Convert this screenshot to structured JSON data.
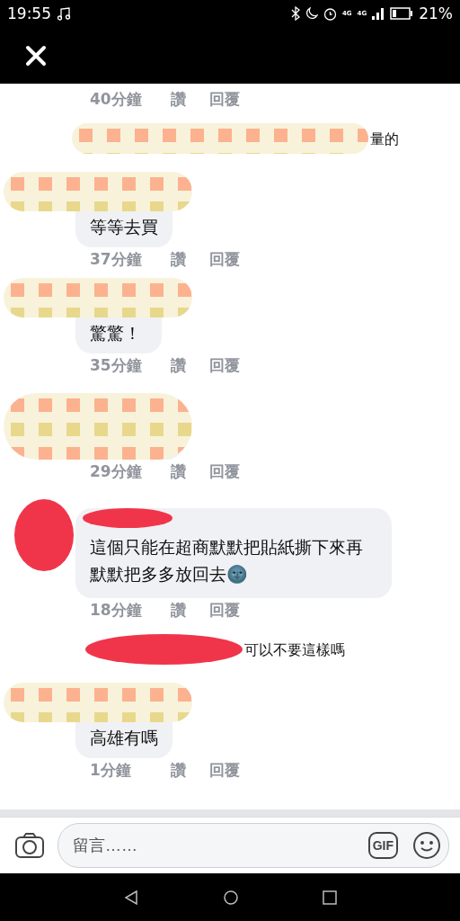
{
  "status_bar": {
    "time": "19:55",
    "network_labels": [
      "4G",
      "4G"
    ],
    "battery_text": "21%"
  },
  "items": [
    {
      "kind": "meta",
      "time": "40分鐘",
      "like": "讚",
      "reply": "回覆"
    },
    {
      "kind": "reply_preview",
      "redaction": {
        "kind": "checker"
      },
      "text": "量的"
    },
    {
      "kind": "comment",
      "redaction": {
        "kind": "checker"
      },
      "text": "等等去買",
      "time": "37分鐘",
      "like": "讚",
      "reply": "回覆"
    },
    {
      "kind": "comment",
      "redaction": {
        "kind": "checker"
      },
      "text": "驚驚！",
      "time": "35分鐘",
      "like": "讚",
      "reply": "回覆"
    },
    {
      "kind": "comment",
      "redaction": {
        "kind": "checker"
      },
      "time": "29分鐘",
      "like": "讚",
      "reply": "回覆"
    },
    {
      "kind": "comment",
      "redaction": {
        "kind": "scribble"
      },
      "text": "這個只能在超商默默把貼紙撕下來再默默把多多放回去🌚",
      "time": "18分鐘",
      "like": "讚",
      "reply": "回覆"
    },
    {
      "kind": "reply_preview",
      "redaction": {
        "kind": "scribble"
      },
      "text": "可以不要這樣嗎"
    },
    {
      "kind": "comment",
      "redaction": {
        "kind": "checker"
      },
      "text": "高雄有嗎",
      "time": "1分鐘",
      "like": "讚",
      "reply": "回覆"
    }
  ],
  "composer": {
    "placeholder": "留言……",
    "gif_label": "GIF"
  }
}
